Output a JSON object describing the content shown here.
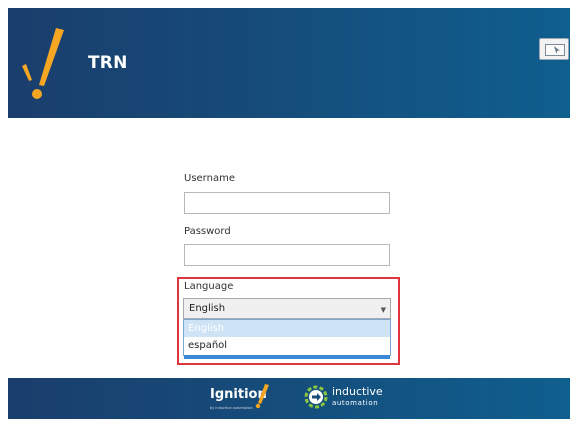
{
  "header": {
    "title": "TRN",
    "logo_icon": "ignition-exclamation-logo",
    "screen_button_icon": "screen-pointer-icon"
  },
  "form": {
    "username_label": "Username",
    "username_value": "",
    "password_label": "Password",
    "password_value": "",
    "language_label": "Language",
    "language_selected": "English",
    "language_options": [
      "English",
      "español"
    ]
  },
  "footer": {
    "brand_ignition": "Ignition",
    "brand_ignition_sub": "by inductive automation",
    "brand_ia_name": "inductive",
    "brand_ia_sub": "automation"
  },
  "colors": {
    "header_bg": "#164a78",
    "accent_orange": "#f5a623",
    "highlight_red": "#e0353c",
    "selection_blue": "#cfe3f6"
  }
}
